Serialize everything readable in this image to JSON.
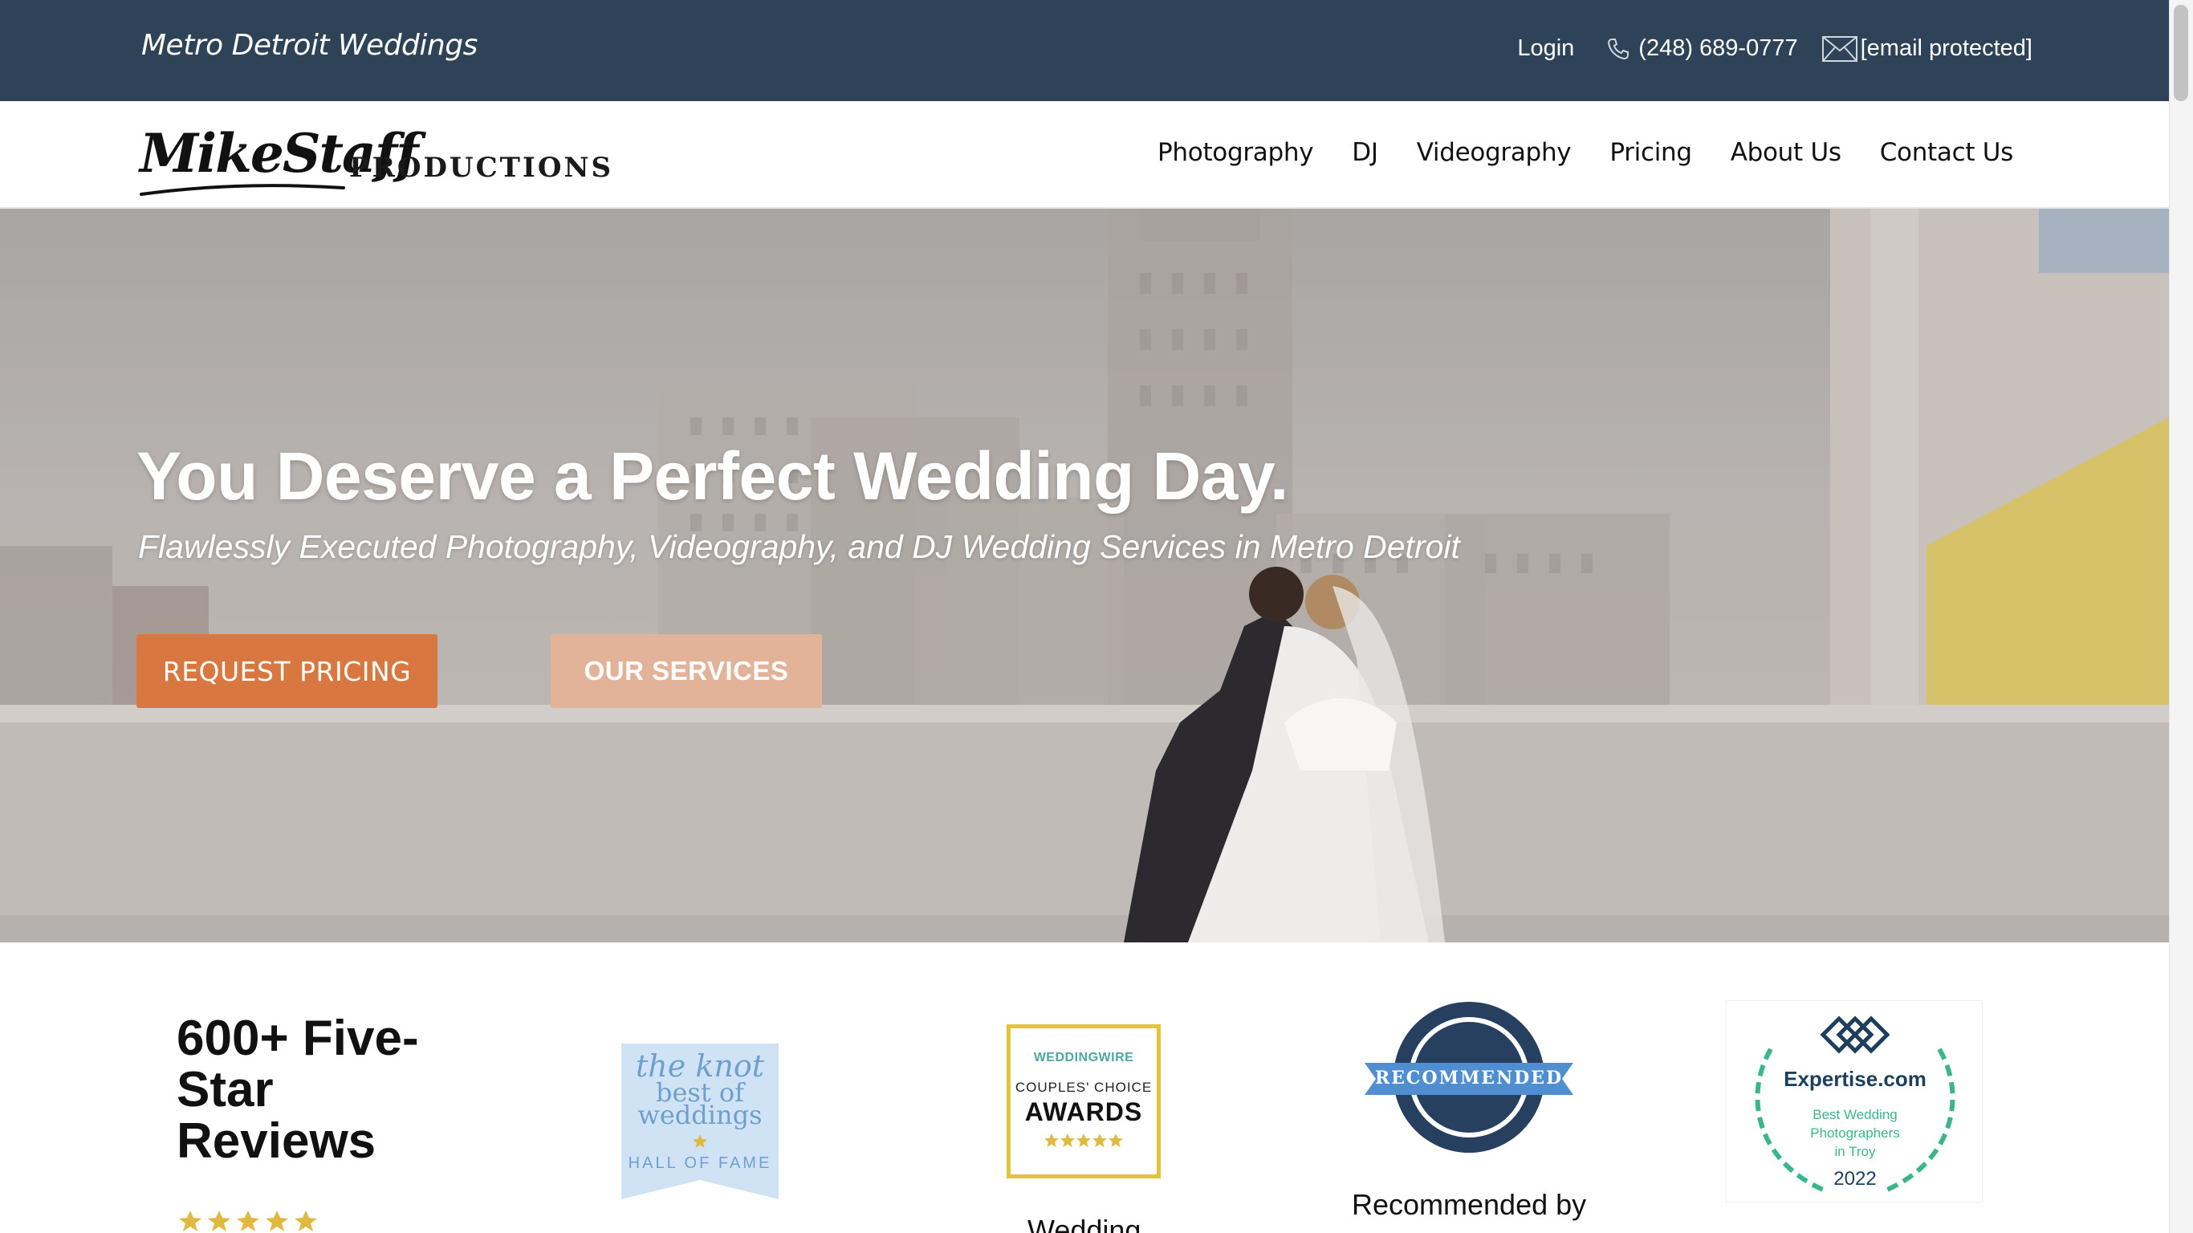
{
  "topbar": {
    "site_name": "Metro Detroit Weddings",
    "login": "Login",
    "phone": "(248) 689-0777",
    "email": "[email protected]"
  },
  "logo": {
    "script": "MikeStaff",
    "word": "PRODUCTIONS"
  },
  "nav": {
    "items": [
      "Photography",
      "DJ",
      "Videography",
      "Pricing",
      "About Us",
      "Contact Us"
    ]
  },
  "hero": {
    "title": "You Deserve a Perfect Wedding Day.",
    "subtitle": "Flawlessly Executed Photography, Videography, and DJ Wedding Services in Metro Detroit",
    "primary_button": "REQUEST PRICING",
    "secondary_button": "OUR SERVICES"
  },
  "awards": {
    "reviews_heading": "600+ Five-Star Reviews",
    "reviews_rating_stars": 5,
    "knot": {
      "line1": "the knot",
      "line2": "best of",
      "line3": "weddings",
      "line4": "HALL OF FAME"
    },
    "weddingwire": {
      "brand": "WEDDINGWIRE",
      "line1": "COUPLES' CHOICE",
      "line2": "AWARDS",
      "caption": "Wedding"
    },
    "recommended": {
      "ribbon": "RECOMMENDED",
      "caption": "Recommended by"
    },
    "expertise": {
      "brand": "Expertise.com",
      "line1": "Best Wedding",
      "line2": "Photographers",
      "line3": "in Troy",
      "year": "2022"
    }
  },
  "colors": {
    "topbar": "#2f4358",
    "primary_button": "#d8773f",
    "secondary_button": "#e3b399",
    "knot_blue": "#6f9fcf",
    "weddingwire_gold": "#e3c33a",
    "recommended_navy": "#27405f",
    "expertise_teal": "#3bb68b"
  }
}
